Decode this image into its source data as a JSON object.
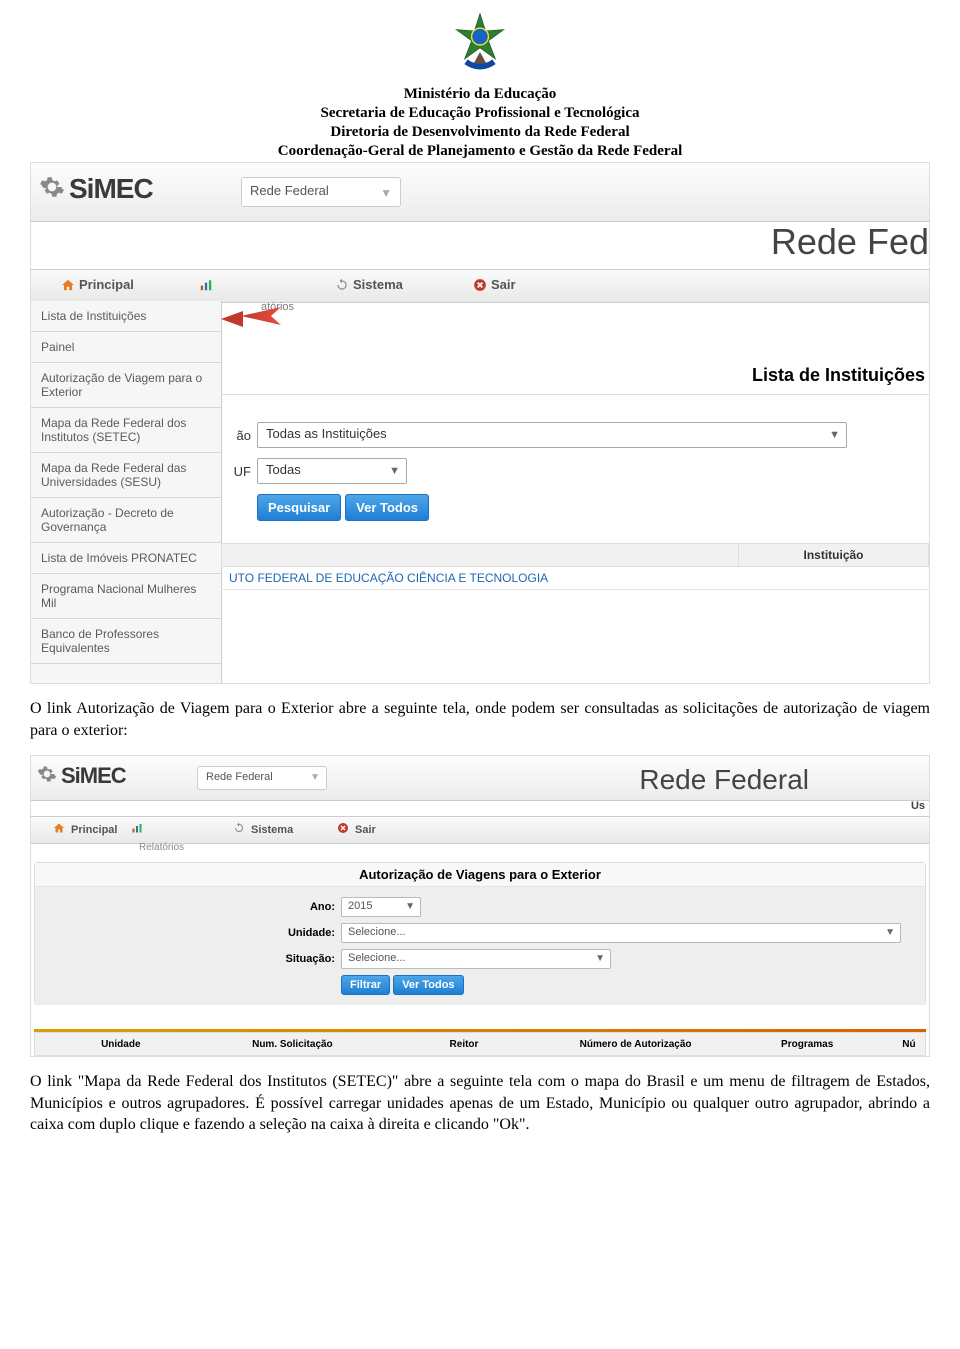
{
  "header": {
    "line1": "Ministério da Educação",
    "line2": "Secretaria de Educação Profissional e Tecnológica",
    "line3": "Diretoria de Desenvolvimento da Rede Federal",
    "line4": "Coordenação-Geral de Planejamento e Gestão da Rede Federal"
  },
  "shot1": {
    "logo": "SiMEC",
    "module": "Rede Federal",
    "big_title": "Rede Fed",
    "nav": {
      "principal": "Principal",
      "relatorios": "atórios",
      "sistema": "Sistema",
      "sair": "Sair"
    },
    "side_items": [
      "Lista de Instituições",
      "Painel",
      "Autorização de Viagem para o Exterior",
      "Mapa da Rede Federal dos Institutos (SETEC)",
      "Mapa da Rede Federal das Universidades (SESU)",
      "Autorização - Decreto de Governança",
      "Lista de Imóveis PRONATEC",
      "Programa Nacional Mulheres Mil",
      "Banco de Professores Equivalentes"
    ],
    "section_title": "Lista de Instituições",
    "form": {
      "label_inst": "ão",
      "value_inst": "Todas as Instituições",
      "label_uf": "UF",
      "value_uf": "Todas",
      "btn_pesquisar": "Pesquisar",
      "btn_vertodos": "Ver Todos"
    },
    "table": {
      "th_inst": "Instituição",
      "row1": "UTO FEDERAL DE EDUCAÇÃO CIÊNCIA E TECNOLOGIA"
    }
  },
  "para1": "O link Autorização de Viagem para o Exterior abre a seguinte tela, onde podem ser consultadas as solicitações de autorização de viagem para o exterior:",
  "shot2": {
    "logo": "SiMEC",
    "module": "Rede Federal",
    "big_title": "Rede Federal",
    "us": "Us",
    "nav": {
      "principal": "Principal",
      "sistema": "Sistema",
      "sair": "Sair",
      "relatorios": "Relatórios"
    },
    "panel_title": "Autorização de Viagens para o Exterior",
    "form": {
      "ano_label": "Ano:",
      "ano_value": "2015",
      "unidade_label": "Unidade:",
      "unidade_value": "Selecione...",
      "situacao_label": "Situação:",
      "situacao_value": "Selecione...",
      "btn_filtrar": "Filtrar",
      "btn_vertodos": "Ver Todos"
    },
    "thead": [
      "Unidade",
      "Num. Solicitação",
      "Reitor",
      "Número de Autorização",
      "Programas",
      "Nú"
    ]
  },
  "para2": "O link \"Mapa da Rede Federal dos Institutos (SETEC)\" abre a seguinte tela com o mapa do Brasil e um menu de filtragem de Estados, Municípios e outros agrupadores. É possível carregar unidades apenas de um Estado, Município ou qualquer outro agrupador, abrindo a caixa com duplo clique e fazendo a seleção na caixa à direita e clicando \"Ok\"."
}
